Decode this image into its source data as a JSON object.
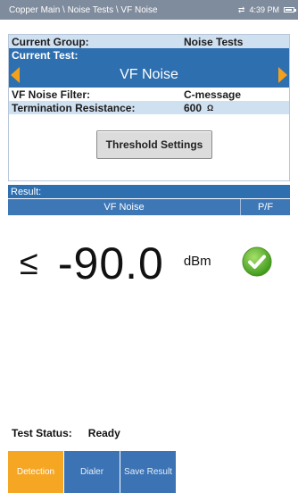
{
  "header": {
    "breadcrumb": "Copper Main \\ Noise Tests \\ VF Noise",
    "time": "4:39 PM"
  },
  "setup": {
    "current_group_label": "Current Group:",
    "current_group_value": "Noise Tests",
    "current_test_label": "Current Test:",
    "current_test_value": "VF Noise",
    "filter_label": "VF Noise Filter:",
    "filter_value": "C-message",
    "termination_label": "Termination Resistance:",
    "termination_value": "600",
    "termination_unit": "Ω",
    "threshold_button": "Threshold Settings"
  },
  "result": {
    "header": "Result:",
    "column_measure": "VF Noise",
    "column_pf": "P/F",
    "comparator": "≤",
    "value": "-90.0",
    "unit": "dBm",
    "pf_status_icon": "pass-check-icon",
    "pass_color": "#5fb82e"
  },
  "status": {
    "label": "Test Status:",
    "value": "Ready"
  },
  "toolbar": {
    "detection": "Detection",
    "dialer": "Dialer",
    "save_result": "Save Result"
  },
  "colors": {
    "accent_blue": "#2e6fb0",
    "highlight_orange": "#f5a623",
    "light_blue": "#cfe0f1"
  }
}
